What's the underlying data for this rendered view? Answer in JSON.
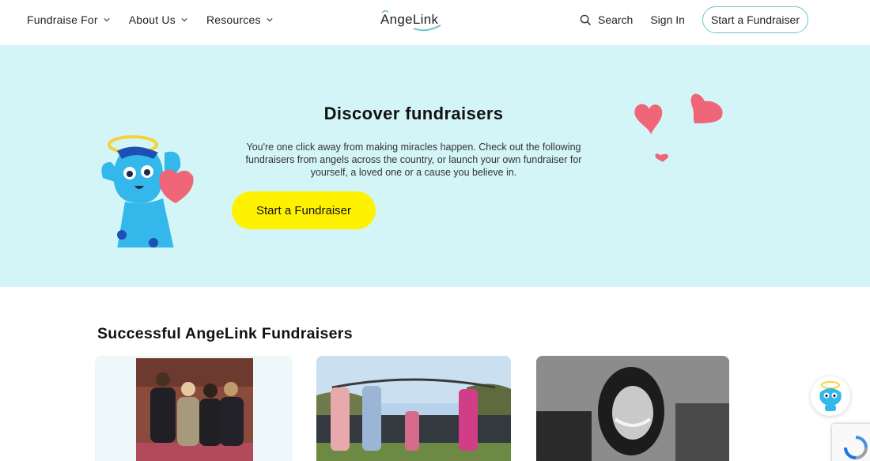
{
  "header": {
    "logo_text": "AngeLink",
    "nav": [
      {
        "label": "Fundraise For"
      },
      {
        "label": "About Us"
      },
      {
        "label": "Resources"
      }
    ],
    "search_label": "Search",
    "signin_label": "Sign In",
    "start_label": "Start a Fundraiser"
  },
  "hero": {
    "title": "Discover fundraisers",
    "description": "You're one click away from making miracles happen. Check out the following fundraisers from angels across the country, or launch your own fundraiser for yourself, a loved one or a cause you believe in.",
    "cta_label": "Start a Fundraiser"
  },
  "section": {
    "title": "Successful AngeLink Fundraisers"
  },
  "colors": {
    "accent_teal": "#6cc3c9",
    "hero_bg": "#d4f5f8",
    "cta_yellow": "#fff200",
    "heart_pink": "#ee6677"
  },
  "icons": [
    "chevron-down-icon",
    "search-icon",
    "angel-mascot",
    "heart-icon",
    "chatbot-icon",
    "recaptcha-icon"
  ]
}
